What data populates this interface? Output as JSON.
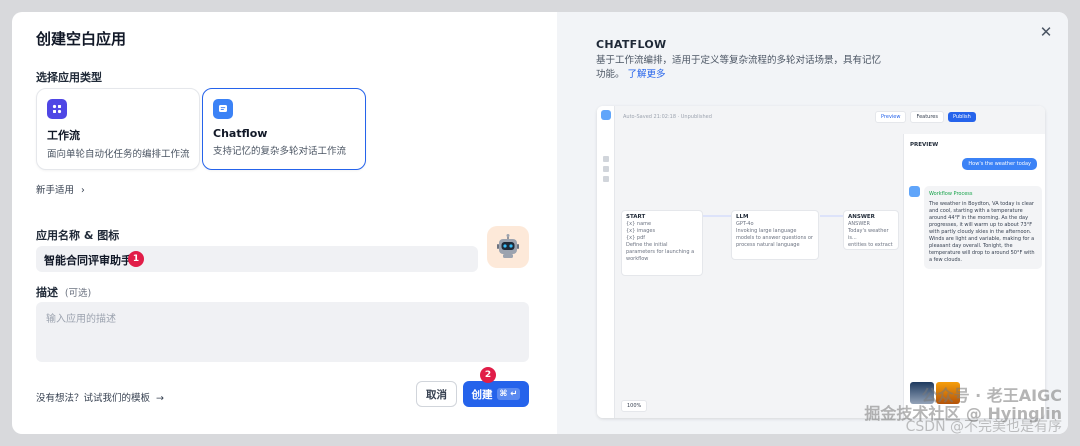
{
  "modal": {
    "title": "创建空白应用",
    "close_icon": "close-icon"
  },
  "app_type": {
    "label": "选择应用类型",
    "cards": [
      {
        "name": "工作流",
        "desc": "面向单轮自动化任务的编排工作流",
        "icon": "workflow-icon",
        "color": "#4f46e5",
        "selected": false
      },
      {
        "name": "Chatflow",
        "desc": "支持记忆的复杂多轮对话工作流",
        "icon": "chatflow-icon",
        "color": "#3b82f6",
        "selected": true
      }
    ],
    "newbie_link": "新手适用"
  },
  "name_field": {
    "label": "应用名称 & 图标",
    "value": "智能合同评审助手",
    "badge": "1"
  },
  "desc_field": {
    "label": "描述",
    "optional": "(可选)",
    "placeholder": "输入应用的描述"
  },
  "footer": {
    "template_link": "没有想法？试试我们的模板",
    "cancel": "取消",
    "create": "创建",
    "create_shortcut": "⌘ ↵",
    "badge": "2"
  },
  "preview_panel": {
    "title": "CHATFLOW",
    "desc": "基于工作流编排，适用于定义等复杂流程的多轮对话场景，具有记忆功能。",
    "learn_more": "了解更多",
    "app_title": "Auto-Saved 21:02:18 · Unpublished",
    "preview_button": "Preview",
    "features_button": "Features",
    "publish_button": "Publish",
    "nodes": [
      {
        "name": "START",
        "lines": [
          "{x} name",
          "{x} images",
          "{x} pdf",
          "Define the initial parameters for launching a workflow"
        ]
      },
      {
        "name": "LLM",
        "lines": [
          "GPT-4o",
          "Invoking large language models to answer questions or process natural language"
        ]
      },
      {
        "name": "ANSWER",
        "lines": [
          "ANSWER",
          "Today's weather is...",
          "entities to extract"
        ]
      }
    ],
    "chat_title": "PREVIEW",
    "user_message": "How's the weather today",
    "workflow_process": "Workflow Process",
    "bot_message": "The weather in Boydton, VA today is clear and cool, starting with a temperature around 44°F in the morning. As the day progresses, it will warm up to about 73°F with partly cloudy skies in the afternoon. Winds are light and variable, making for a pleasant day overall. Tonight, the temperature will drop to around 50°F with a few clouds.",
    "zoom": "100%"
  },
  "watermark": {
    "line1": "公众号 · 老王AIGC",
    "line2": "掘金技术社区 @ Hyinglin",
    "line3": "CSDN @不完美也是有序"
  }
}
